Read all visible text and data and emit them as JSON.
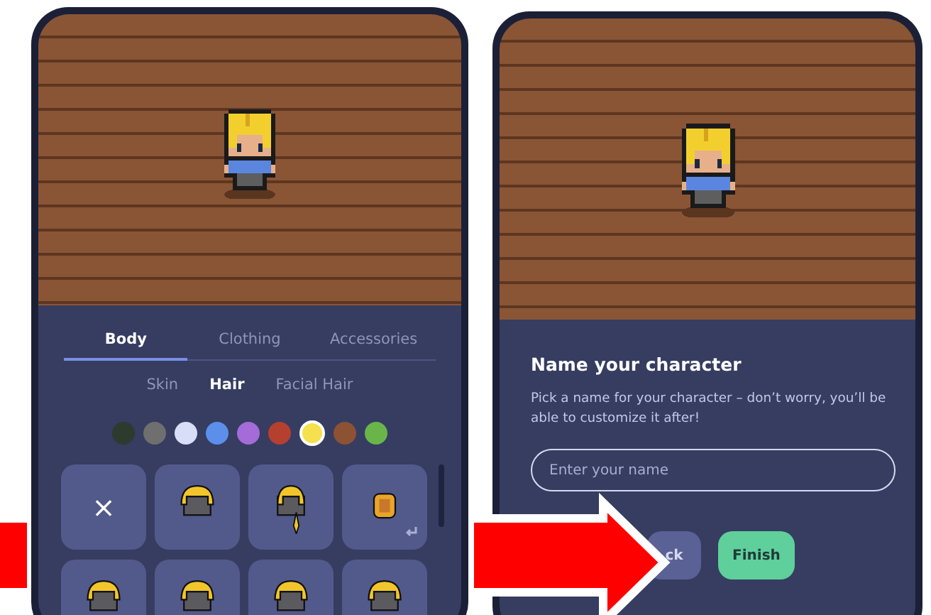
{
  "screens": [
    {
      "kind": "customizer",
      "tabs": [
        {
          "label": "Body",
          "selected": true
        },
        {
          "label": "Clothing",
          "selected": false
        },
        {
          "label": "Accessories",
          "selected": false
        }
      ],
      "subtabs": [
        {
          "label": "Skin",
          "selected": false
        },
        {
          "label": "Hair",
          "selected": true
        },
        {
          "label": "Facial Hair",
          "selected": false
        }
      ],
      "colors": [
        {
          "color": "#2d3a2e",
          "selected": false
        },
        {
          "color": "#6f6f6f",
          "selected": false
        },
        {
          "color": "#d8def8",
          "selected": false
        },
        {
          "color": "#5b8fea",
          "selected": false
        },
        {
          "color": "#a46bd9",
          "selected": false
        },
        {
          "color": "#b5402f",
          "selected": false
        },
        {
          "color": "#f5e04d",
          "selected": true
        },
        {
          "color": "#8d5234",
          "selected": false
        },
        {
          "color": "#6ab54a",
          "selected": false
        }
      ],
      "tiles": [
        {
          "kind": "none",
          "label": "×"
        },
        {
          "kind": "short"
        },
        {
          "kind": "braid"
        },
        {
          "kind": "back"
        },
        {
          "kind": "short"
        },
        {
          "kind": "short"
        },
        {
          "kind": "short"
        },
        {
          "kind": "short"
        }
      ]
    },
    {
      "kind": "naming",
      "title": "Name your character",
      "description": "Pick a name for your character – don’t worry, you’ll be able to customize it after!",
      "name_field": {
        "placeholder": "Enter your name"
      },
      "buttons": [
        {
          "kind": "secondary",
          "label": "ck"
        },
        {
          "kind": "primary",
          "label": "Finish"
        }
      ]
    }
  ]
}
